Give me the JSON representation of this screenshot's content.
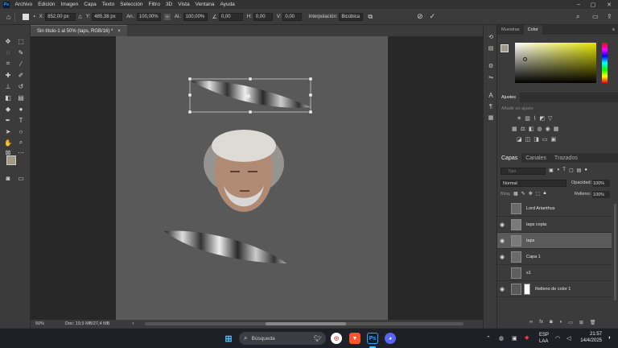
{
  "menubar": {
    "items": [
      "Archivo",
      "Edición",
      "Imagen",
      "Capa",
      "Texto",
      "Selección",
      "Filtro",
      "3D",
      "Vista",
      "Ventana",
      "Ayuda"
    ]
  },
  "options": {
    "x_label": "X:",
    "x_value": "852,00 px",
    "y_label": "Y:",
    "y_value": "485,38 px",
    "w_label": "An.:",
    "w_value": "100,00%",
    "h_label": "Al.:",
    "h_value": "100,00%",
    "angle_value": "0,00",
    "hskew_label": "H:",
    "hskew_value": "0,00",
    "vskew_label": "V:",
    "vskew_value": "0,00",
    "interp_label": "Interpolación:",
    "interp_value": "Bicúbica"
  },
  "document": {
    "tab_title": "Sin título-1 al 50% (taps, RGB/16) *",
    "tab_close": "×"
  },
  "status": {
    "zoom": "50%",
    "doc_info": "Doc: 19,5 MB/27,4 MB"
  },
  "color_panel": {
    "tabs": [
      "Muestras",
      "Color"
    ],
    "active_tab": "Color",
    "hue": "#e5e500"
  },
  "adjustments_panel": {
    "title": "Ajustes",
    "subtitle": "Añadir un ajuste"
  },
  "layers_panel": {
    "tabs": [
      "Capas",
      "Canales",
      "Trazados"
    ],
    "search_placeholder": "Tipo",
    "blend_mode": "Normal",
    "opacity_label": "Opacidad:",
    "opacity_value": "100%",
    "lock_label": "Bloq.:",
    "fill_label": "Relleno:",
    "fill_value": "100%",
    "layers": [
      {
        "name": "Lord Arianthus",
        "visible": false
      },
      {
        "name": "taps copia",
        "visible": true
      },
      {
        "name": "taps",
        "visible": true,
        "selected": true
      },
      {
        "name": "Capa 1",
        "visible": true
      },
      {
        "name": "s1",
        "visible": false
      },
      {
        "name": "Relleno de color 1",
        "visible": true
      }
    ]
  },
  "taskbar": {
    "search_placeholder": "Búsqueda",
    "lang_top": "ESP",
    "lang_bottom": "LAA",
    "time": "21:57",
    "date": "14/4/2025"
  }
}
